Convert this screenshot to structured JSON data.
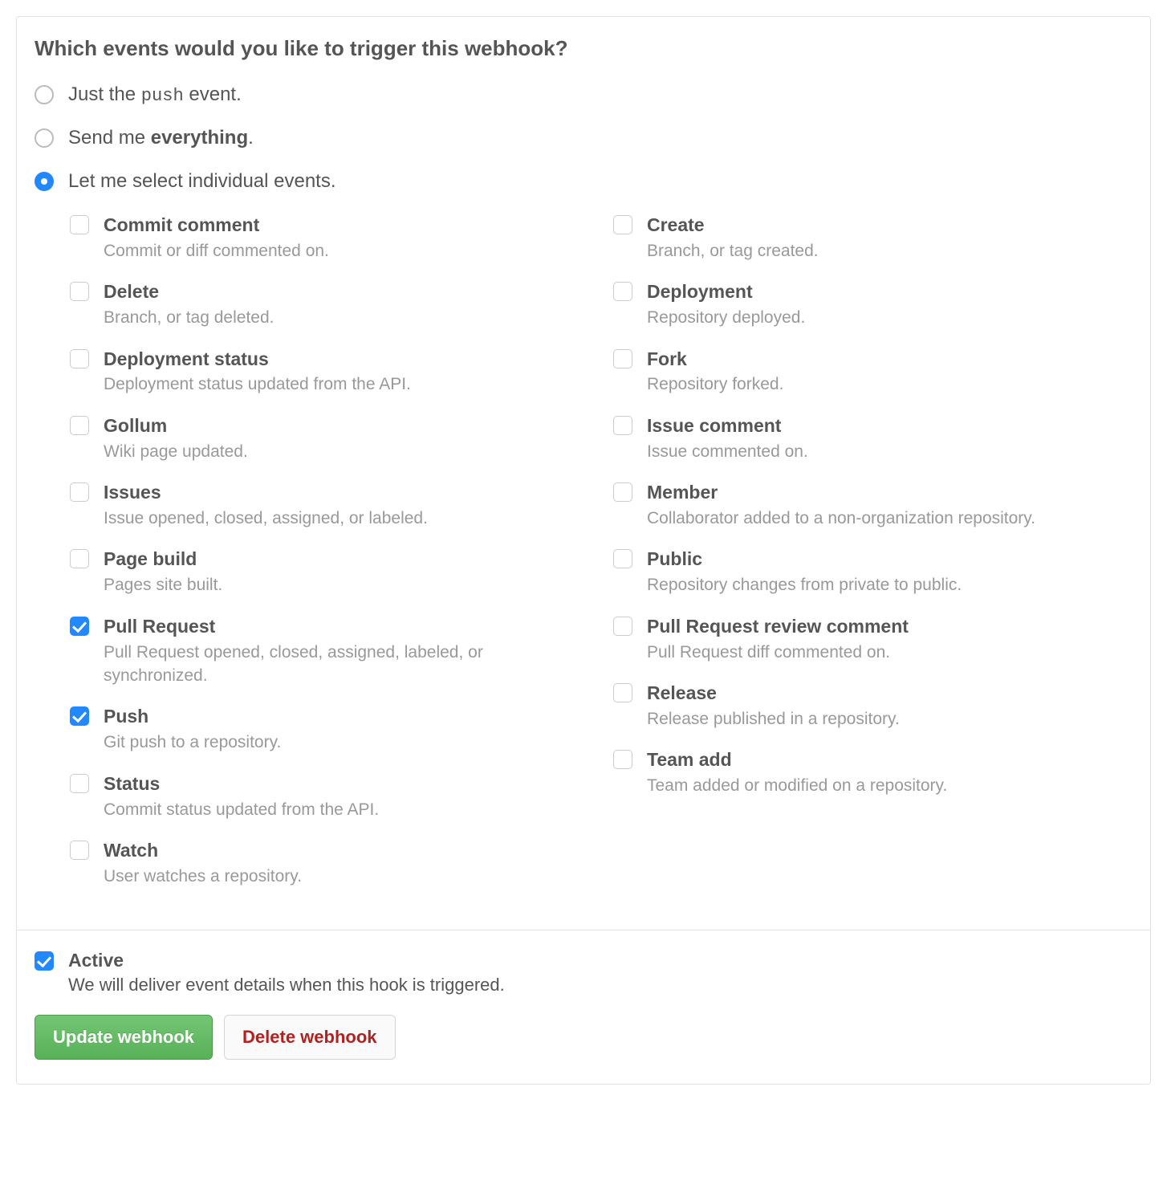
{
  "header": {
    "title": "Which events would you like to trigger this webhook?"
  },
  "trigger_options": [
    {
      "id": "just-push",
      "label_pre": "Just the ",
      "label_code": "push",
      "label_post": " event.",
      "selected": false
    },
    {
      "id": "everything",
      "label_pre": "Send me ",
      "label_strong": "everything",
      "label_post": ".",
      "selected": false
    },
    {
      "id": "individual",
      "label_plain": "Let me select individual events.",
      "selected": true
    }
  ],
  "events": {
    "left": [
      {
        "id": "commit-comment",
        "title": "Commit comment",
        "desc": "Commit or diff commented on.",
        "checked": false
      },
      {
        "id": "delete",
        "title": "Delete",
        "desc": "Branch, or tag deleted.",
        "checked": false
      },
      {
        "id": "deployment-status",
        "title": "Deployment status",
        "desc": "Deployment status updated from the API.",
        "checked": false
      },
      {
        "id": "gollum",
        "title": "Gollum",
        "desc": "Wiki page updated.",
        "checked": false
      },
      {
        "id": "issues",
        "title": "Issues",
        "desc": "Issue opened, closed, assigned, or labeled.",
        "checked": false
      },
      {
        "id": "page-build",
        "title": "Page build",
        "desc": "Pages site built.",
        "checked": false
      },
      {
        "id": "pull-request",
        "title": "Pull Request",
        "desc": "Pull Request opened, closed, assigned, labeled, or synchronized.",
        "checked": true
      },
      {
        "id": "push",
        "title": "Push",
        "desc": "Git push to a repository.",
        "checked": true
      },
      {
        "id": "status",
        "title": "Status",
        "desc": "Commit status updated from the API.",
        "checked": false
      },
      {
        "id": "watch",
        "title": "Watch",
        "desc": "User watches a repository.",
        "checked": false
      }
    ],
    "right": [
      {
        "id": "create",
        "title": "Create",
        "desc": "Branch, or tag created.",
        "checked": false
      },
      {
        "id": "deployment",
        "title": "Deployment",
        "desc": "Repository deployed.",
        "checked": false
      },
      {
        "id": "fork",
        "title": "Fork",
        "desc": "Repository forked.",
        "checked": false
      },
      {
        "id": "issue-comment",
        "title": "Issue comment",
        "desc": "Issue commented on.",
        "checked": false
      },
      {
        "id": "member",
        "title": "Member",
        "desc": "Collaborator added to a non-organization repository.",
        "checked": false
      },
      {
        "id": "public",
        "title": "Public",
        "desc": "Repository changes from private to public.",
        "checked": false
      },
      {
        "id": "pr-review-comment",
        "title": "Pull Request review comment",
        "desc": "Pull Request diff commented on.",
        "checked": false
      },
      {
        "id": "release",
        "title": "Release",
        "desc": "Release published in a repository.",
        "checked": false
      },
      {
        "id": "team-add",
        "title": "Team add",
        "desc": "Team added or modified on a repository.",
        "checked": false
      }
    ]
  },
  "active": {
    "title": "Active",
    "desc": "We will deliver event details when this hook is triggered.",
    "checked": true
  },
  "buttons": {
    "update": "Update webhook",
    "delete": "Delete webhook"
  }
}
